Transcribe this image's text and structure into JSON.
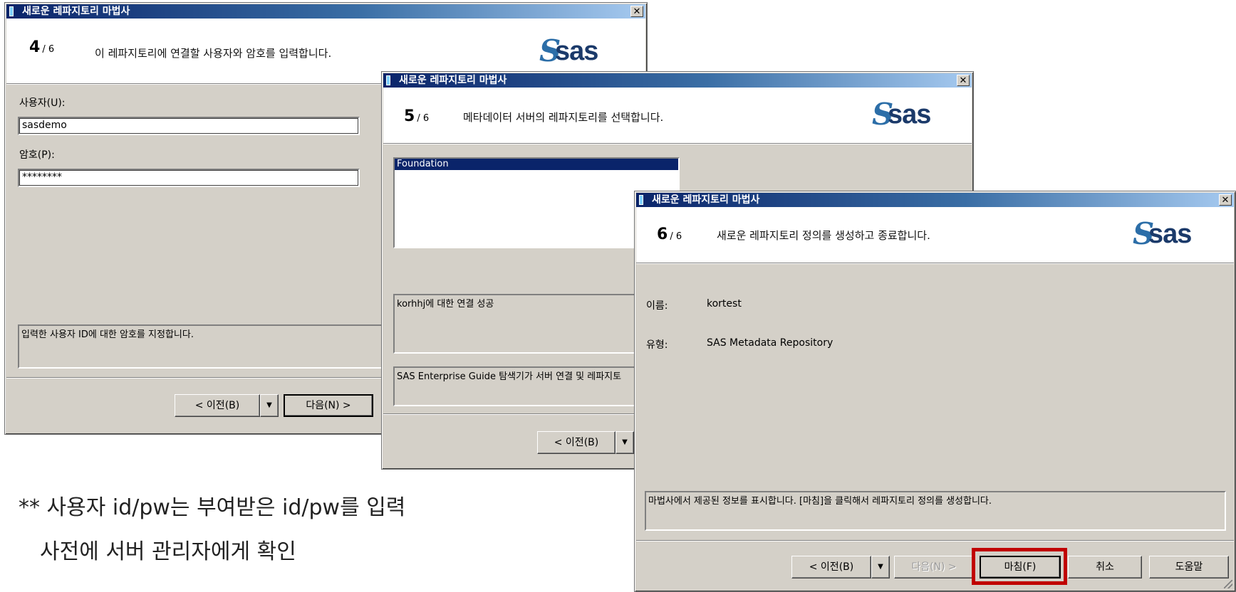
{
  "wizard_title": "새로운 레파지토리 마법사",
  "close_glyph": "✕",
  "dialog1": {
    "step": "4",
    "total": "/ 6",
    "header_text": "이 레파지토리에 연결할 사용자와 암호를 입력합니다.",
    "user_label": "사용자(U):",
    "user_value": "sasdemo",
    "password_label": "암호(P):",
    "password_value": "********",
    "help_text": "입력한 사용자 ID에 대한 암호를 지정합니다.",
    "back_label": "< 이전(B)",
    "next_label": "다음(N) >"
  },
  "dialog2": {
    "step": "5",
    "total": "/ 6",
    "header_text": "메타데이터 서버의 레파지토리를 선택합니다.",
    "list_items": [
      "Foundation"
    ],
    "status_text": "korhhj에 대한 연결 성공",
    "help_text": "SAS Enterprise Guide 탐색기가 서버 연결 및 레파지토",
    "back_label": "< 이전(B)"
  },
  "dialog3": {
    "step": "6",
    "total": "/ 6",
    "header_text": "새로운 레파지토리 정의를 생성하고 종료합니다.",
    "name_label": "이름:",
    "name_value": "kortest",
    "type_label": "유형:",
    "type_value": "SAS Metadata Repository",
    "help_text": "마법사에서 제공된 정보를 표시합니다. [마침]을 클릭해서 레파지토리 정의를 생성합니다.",
    "back_label": "< 이전(B)",
    "next_label": "다음(N) >",
    "finish_label": "마침(F)",
    "cancel_label": "취소",
    "help_label": "도움말"
  },
  "logo_text": "sas",
  "logo_mark": "S",
  "caption": {
    "line1": "** 사용자 id/pw는 부여받은 id/pw를 입력",
    "line2": "사전에 서버 관리자에게 확인"
  },
  "colors": {
    "titlebar": "#0a246a",
    "highlight": "#c00000",
    "window": "#d4d0c8"
  }
}
